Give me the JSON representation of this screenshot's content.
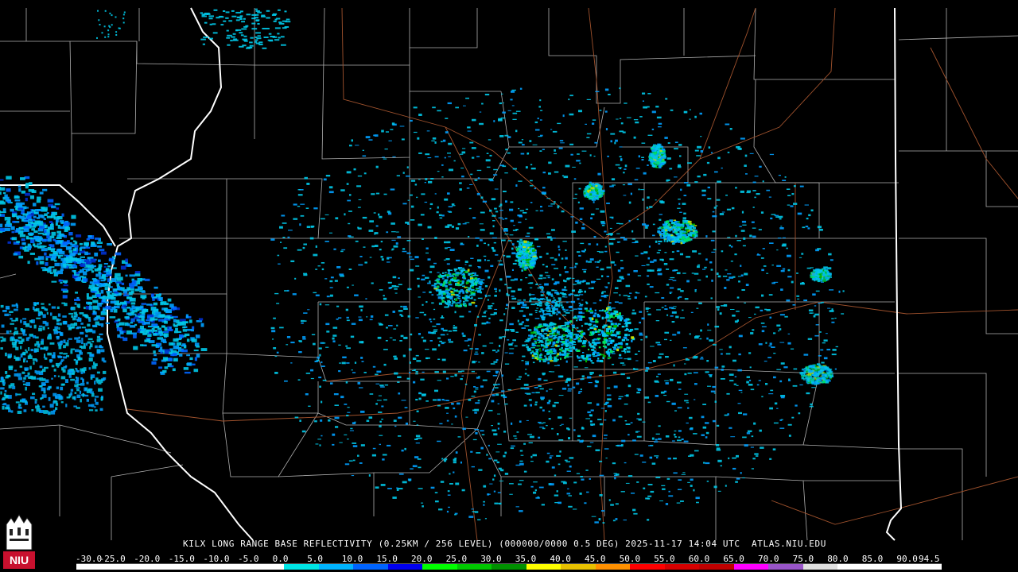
{
  "caption": "KILX LONG RANGE BASE REFLECTIVITY (0.25KM / 256 LEVEL) (000000/0000 0.5 DEG) 2025-11-17 14:04 UTC  ATLAS.NIU.EDU",
  "legend": {
    "labels": [
      "-30.0",
      "-25.0",
      "-20.0",
      "-15.0",
      "-10.0",
      "-5.0",
      "0.0",
      "5.0",
      "10.0",
      "15.0",
      "20.0",
      "25.0",
      "30.0",
      "35.0",
      "40.0",
      "45.0",
      "50.0",
      "55.0",
      "60.0",
      "65.0",
      "70.0",
      "75.0",
      "80.0",
      "85.0",
      "90.0",
      "94.5"
    ],
    "colors": [
      "#ffffff",
      "#ffffff",
      "#ffffff",
      "#ffffff",
      "#ffffff",
      "#ffffff",
      "#00e5e5",
      "#00b4ff",
      "#0064ff",
      "#0000f0",
      "#00ff00",
      "#00c800",
      "#009000",
      "#ffff00",
      "#e7c000",
      "#ff9000",
      "#ff0000",
      "#d60000",
      "#c00000",
      "#ff00ff",
      "#9955c9",
      "#e0e0e0",
      "#ffffff",
      "#ffffff",
      "#ffffff"
    ]
  },
  "logo": {
    "text": "NIU",
    "color": "#c8102e"
  },
  "map": {
    "background": "#000000",
    "county_line_color": "#ffffff",
    "highway_color": "#a0522d",
    "state_line_color": "#ffffff",
    "echo_colors": [
      "#00c8e8",
      "#00a0ff",
      "#0064ff",
      "#0030d0",
      "#00e060",
      "#00b000",
      "#c8e000"
    ]
  }
}
